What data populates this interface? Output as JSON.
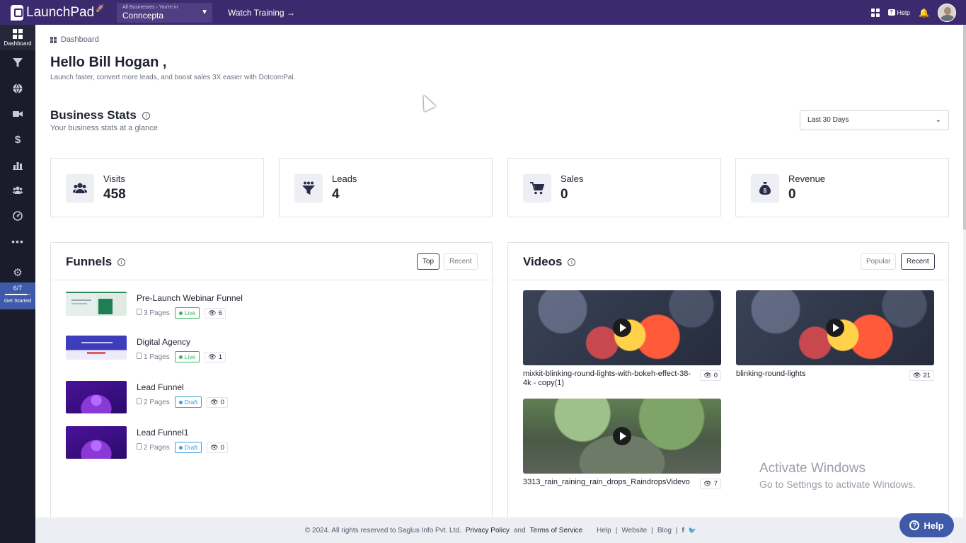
{
  "topbar": {
    "brand": "LaunchPad",
    "business_hint": "All Businesses › You're in",
    "business_name": "Conncepta",
    "watch_training": "Watch Training →",
    "help_label": "Help"
  },
  "sidebar": {
    "items": [
      {
        "label": "Dashboard",
        "icon": "dashboard-icon"
      },
      {
        "label": "",
        "icon": "funnel-icon"
      },
      {
        "label": "",
        "icon": "globe-icon"
      },
      {
        "label": "",
        "icon": "video-icon"
      },
      {
        "label": "",
        "icon": "dollar-icon"
      },
      {
        "label": "",
        "icon": "chart-icon"
      },
      {
        "label": "",
        "icon": "users-icon"
      },
      {
        "label": "",
        "icon": "speedometer-icon"
      },
      {
        "label": "",
        "icon": "more-icon"
      },
      {
        "label": "",
        "icon": "gear-icon"
      }
    ],
    "progress": {
      "count": "6/7",
      "label": "Get Started",
      "fraction": 0.857
    }
  },
  "breadcrumb": "Dashboard",
  "greeting": "Hello Bill Hogan ,",
  "tagline": "Launch faster, convert more leads, and boost sales 3X easier with DotcomPal.",
  "stats": {
    "title": "Business Stats",
    "subtitle": "Your business stats at a glance",
    "range": "Last 30 Days",
    "cards": [
      {
        "label": "Visits",
        "value": "458"
      },
      {
        "label": "Leads",
        "value": "4"
      },
      {
        "label": "Sales",
        "value": "0"
      },
      {
        "label": "Revenue",
        "value": "0"
      }
    ]
  },
  "funnels": {
    "title": "Funnels",
    "toggle_top": "Top",
    "toggle_recent": "Recent",
    "items": [
      {
        "name": "Pre-Launch Webinar Funnel",
        "pages": "3 Pages",
        "status": "Live",
        "views": "6"
      },
      {
        "name": "Digital Agency",
        "pages": "1 Pages",
        "status": "Live",
        "views": "1"
      },
      {
        "name": "Lead Funnel",
        "pages": "2 Pages",
        "status": "Draft",
        "views": "0"
      },
      {
        "name": "Lead Funnel1",
        "pages": "2 Pages",
        "status": "Draft",
        "views": "0"
      }
    ]
  },
  "videos": {
    "title": "Videos",
    "toggle_popular": "Popular",
    "toggle_recent": "Recent",
    "items": [
      {
        "title": "mixkit-blinking-round-lights-with-bokeh-effect-38-4k - copy(1)",
        "views": "0"
      },
      {
        "title": "blinking-round-lights",
        "views": "21"
      },
      {
        "title": "3313_rain_raining_rain_drops_RaindropsVidevo",
        "views": "7"
      }
    ]
  },
  "watermark": {
    "line1": "Activate Windows",
    "line2": "Go to Settings to activate Windows."
  },
  "footer": {
    "copyright": "© 2024. All rights reserved to Saglus Info Pvt. Ltd.",
    "privacy": "Privacy Policy",
    "and": "and",
    "terms": "Terms of Service",
    "help": "Help",
    "website": "Website",
    "blog": "Blog",
    "sep": "|"
  },
  "help_button": "Help",
  "colors": {
    "topbar": "#3b2a6e",
    "sidebar": "#1b1c2b",
    "live": "#3db35a",
    "draft": "#3b9fd8",
    "help_fab": "#3f5aa8"
  }
}
